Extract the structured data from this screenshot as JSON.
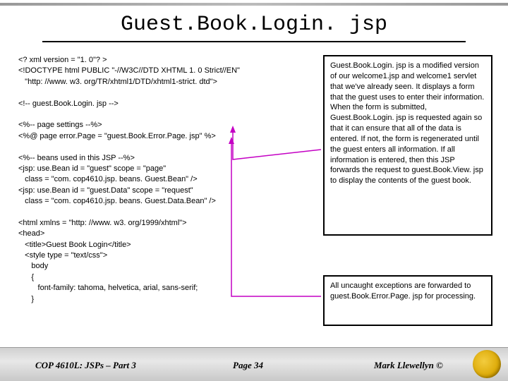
{
  "title": "Guest.Book.Login. jsp",
  "code": "<? xml version = \"1. 0\"? >\n<!DOCTYPE html PUBLIC \"-//W3C//DTD XHTML 1. 0 Strict//EN\"\n   \"http: //www. w3. org/TR/xhtml1/DTD/xhtml1-strict. dtd\">\n\n<!-- guest.Book.Login. jsp -->\n\n<%-- page settings --%>\n<%@ page error.Page = \"guest.Book.Error.Page. jsp\" %>\n\n<%-- beans used in this JSP --%>\n<jsp: use.Bean id = \"guest\" scope = \"page\"\n   class = \"com. cop4610.jsp. beans. Guest.Bean\" />\n<jsp: use.Bean id = \"guest.Data\" scope = \"request\"\n   class = \"com. cop4610.jsp. beans. Guest.Data.Bean\" />\n\n<html xmlns = \"http: //www. w3. org/1999/xhtml\">\n<head>\n   <title>Guest Book Login</title>\n   <style type = \"text/css\">\n      body\n      {\n         font-family: tahoma, helvetica, arial, sans-serif;\n      }",
  "box1": "Guest.Book.Login. jsp is a modified version of our welcome1.jsp and welcome1 servlet that we've already seen.  It displays a form that the guest uses to enter their information.  When the form is submitted, Guest.Book.Login. jsp is requested again so that it can ensure that all of the data is entered.  If not, the form is regenerated until the guest enters all information.  If all information is entered, then this JSP forwards the request to guest.Book.View. jsp to display the contents of the guest book.",
  "box2": "All uncaught exceptions are forwarded to guest.Book.Error.Page. jsp for processing.",
  "footer": {
    "left": "COP 4610L: JSPs – Part 3",
    "center": "Page 34",
    "right": "Mark Llewellyn ©"
  }
}
